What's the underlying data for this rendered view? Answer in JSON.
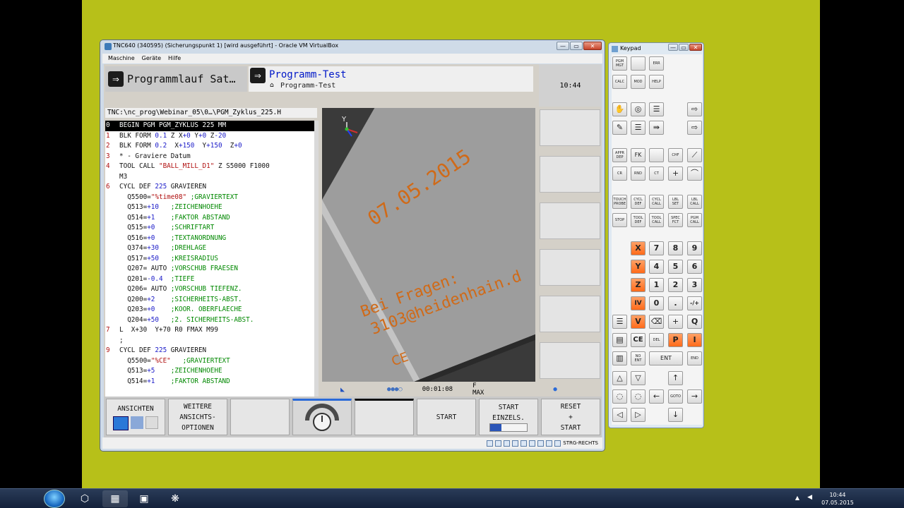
{
  "vbox": {
    "title": "TNC640 (340595) (Sicherungspunkt 1) [wird ausgeführt] - Oracle VM VirtualBox",
    "menu": [
      "Maschine",
      "Geräte",
      "Hilfe"
    ],
    "controls": {
      "minimize": "—",
      "maximize": "▭",
      "close": "✕"
    },
    "status_host_key": "STRG-RECHTS"
  },
  "tnc": {
    "mode_left": "Programmlauf Sat…",
    "mode_right": "Programm-Test",
    "mode_sub": "Programm-Test",
    "clock": "10:44",
    "path": "TNC:\\nc_prog\\Webinar_05\\0…\\PGM_Zyklus_225.H",
    "program_lines": [
      {
        "n": "0",
        "text": "BEGIN PGM PGM_ZYKLUS 225 MM"
      },
      {
        "n": "1",
        "a": "BLK FORM ",
        "b": "0.1",
        "c": " Z X",
        "d": "+0",
        "e": " Y",
        "f": "+0",
        "g": " Z",
        "h": "-20"
      },
      {
        "n": "2",
        "a": "BLK FORM ",
        "b": "0.2",
        "c": "  X",
        "d": "+150",
        "e": "  Y",
        "f": "+150",
        "g": "  Z",
        "h": "+0"
      },
      {
        "n": "3",
        "text": "* - Graviere Datum"
      },
      {
        "n": "4",
        "text1": "TOOL CALL ",
        "str": "\"BALL_MILL_D1\"",
        "text2": " Z S5000 F1000"
      },
      {
        "n": "",
        "text": "M3"
      },
      {
        "n": "6",
        "text1": "CYCL DEF ",
        "num": "225",
        "text2": " GRAVIEREN"
      },
      {
        "n": "",
        "p": "  Q5500=",
        "v": "\"%time08\"",
        "c": " ;GRAVIERTEXT"
      },
      {
        "n": "",
        "p": "  Q513=",
        "v": "+10",
        "c": "   ;ZEICHENHOEHE"
      },
      {
        "n": "",
        "p": "  Q514=",
        "v": "+1",
        "c": "    ;FAKTOR ABSTAND"
      },
      {
        "n": "",
        "p": "  Q515=",
        "v": "+0",
        "c": "    ;SCHRIFTART"
      },
      {
        "n": "",
        "p": "  Q516=",
        "v": "+0",
        "c": "    ;TEXTANORDNUNG"
      },
      {
        "n": "",
        "p": "  Q374=",
        "v": "+30",
        "c": "   ;DREHLAGE"
      },
      {
        "n": "",
        "p": "  Q517=",
        "v": "+50",
        "c": "   ;KREISRADIUS"
      },
      {
        "n": "",
        "p": "  Q207= AUTO",
        "v": "",
        "c": " ;VORSCHUB FRAESEN"
      },
      {
        "n": "",
        "p": "  Q201=",
        "v": "-0.4",
        "c": "  ;TIEFE"
      },
      {
        "n": "",
        "p": "  Q206= AUTO",
        "v": "",
        "c": " ;VORSCHUB TIEFENZ."
      },
      {
        "n": "",
        "p": "  Q200=",
        "v": "+2",
        "c": "    ;SICHERHEITS-ABST."
      },
      {
        "n": "",
        "p": "  Q203=",
        "v": "+0",
        "c": "    ;KOOR. OBERFLAECHE"
      },
      {
        "n": "",
        "p": "  Q204=",
        "v": "+50",
        "c": "   ;2. SICHERHEITS-ABST."
      },
      {
        "n": "7",
        "text": "L  X+30  Y+70 R0 FMAX M99"
      },
      {
        "n": "",
        "text": ";"
      },
      {
        "n": "9",
        "text1": "CYCL DEF ",
        "num": "225",
        "text2": " GRAVIEREN"
      },
      {
        "n": "",
        "p": "  Q5500=",
        "v": "\"%CE\"",
        "c": "   ;GRAVIERTEXT"
      },
      {
        "n": "",
        "p": "  Q513=",
        "v": "+5",
        "c": "    ;ZEICHENHOEHE"
      },
      {
        "n": "",
        "p": "  Q514=",
        "v": "+1",
        "c": "    ;FAKTOR ABSTAND"
      }
    ],
    "graphic_texts": {
      "date": "07.05.2015",
      "line1": "Bei Fragen:",
      "line2": "3103@heidenhain.d",
      "mark": "CE",
      "axis_y": "Y"
    },
    "run_time": "00:01:08",
    "feed": "F MAX",
    "softkeys": {
      "ansichten": "ANSICHTEN",
      "weitere": [
        "WEITERE",
        "ANSICHTS-",
        "OPTIONEN"
      ],
      "start": "START",
      "start_einzels": [
        "START",
        "EINZELS."
      ],
      "reset": [
        "RESET",
        "+",
        "START"
      ]
    }
  },
  "keypad": {
    "title": "Keypad",
    "keys_top": [
      "PGM MGT",
      "ERR",
      "CALC",
      "MOD",
      "HELP"
    ],
    "keys_cycles": [
      "APPR DEP",
      "FK",
      "CHF",
      "CR",
      "RND",
      "CT",
      "TOUCH PROBE",
      "CYCL DEF",
      "CYCL CALL",
      "LBL SET",
      "LBL CALL",
      "STOP",
      "TOOL DEF",
      "TOOL CALL",
      "SPEC FCT",
      "PGM CALL"
    ],
    "axes": [
      "X",
      "Y",
      "Z",
      "IV",
      "V",
      "P",
      "I"
    ],
    "digits": [
      "7",
      "8",
      "9",
      "4",
      "5",
      "6",
      "1",
      "2",
      "3",
      "0",
      ".",
      "-/+"
    ],
    "misc": [
      "Q",
      "CE",
      "DEL",
      "NO ENT",
      "ENT",
      "END",
      "GOTO"
    ]
  },
  "taskbar": {
    "time": "10:44",
    "date": "07.05.2015"
  }
}
